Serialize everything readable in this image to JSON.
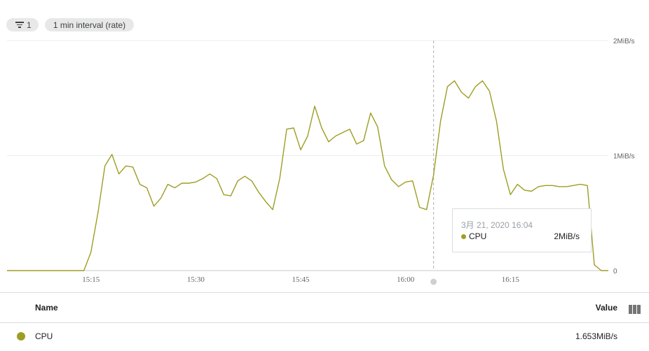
{
  "toolbar": {
    "filter_count": "1",
    "interval_label": "1 min interval (rate)"
  },
  "chart_data": {
    "type": "line",
    "title": "",
    "xlabel": "",
    "ylabel": "",
    "x_unit": "minutes",
    "x_ticks": [
      {
        "x": 915,
        "label": "15:15"
      },
      {
        "x": 930,
        "label": "15:30"
      },
      {
        "x": 945,
        "label": "15:45"
      },
      {
        "x": 960,
        "label": "16:00"
      },
      {
        "x": 975,
        "label": "16:15"
      }
    ],
    "xlim": [
      903,
      989
    ],
    "y_unit": "MiB/s",
    "y_ticks": [
      {
        "y": 0,
        "label": "0"
      },
      {
        "y": 1,
        "label": "1MiB/s"
      },
      {
        "y": 2,
        "label": "2MiB/s"
      }
    ],
    "ylim": [
      0,
      2
    ],
    "grid": true,
    "color": "#9e9d24",
    "series": [
      {
        "name": "CPU",
        "x": [
          903,
          904,
          905,
          906,
          907,
          908,
          909,
          910,
          911,
          912,
          913,
          914,
          915,
          916,
          917,
          918,
          919,
          920,
          921,
          922,
          923,
          924,
          925,
          926,
          927,
          928,
          929,
          930,
          931,
          932,
          933,
          934,
          935,
          936,
          937,
          938,
          939,
          940,
          941,
          942,
          943,
          944,
          945,
          946,
          947,
          948,
          949,
          950,
          951,
          952,
          953,
          954,
          955,
          956,
          957,
          958,
          959,
          960,
          961,
          962,
          963,
          964,
          965,
          966,
          967,
          968,
          969,
          970,
          971,
          972,
          973,
          974,
          975,
          976,
          977,
          978,
          979,
          980,
          981,
          982,
          983,
          984,
          985,
          986,
          987,
          988,
          989
        ],
        "y": [
          0,
          0,
          0,
          0,
          0,
          0,
          0,
          0,
          0,
          0,
          0,
          0,
          0.16,
          0.5,
          0.91,
          1.01,
          0.84,
          0.91,
          0.9,
          0.75,
          0.72,
          0.56,
          0.63,
          0.75,
          0.72,
          0.76,
          0.76,
          0.77,
          0.8,
          0.84,
          0.8,
          0.66,
          0.65,
          0.78,
          0.82,
          0.78,
          0.68,
          0.6,
          0.53,
          0.8,
          1.23,
          1.24,
          1.05,
          1.17,
          1.43,
          1.24,
          1.12,
          1.17,
          1.2,
          1.23,
          1.1,
          1.13,
          1.37,
          1.25,
          0.91,
          0.79,
          0.73,
          0.77,
          0.78,
          0.55,
          0.53,
          0.83,
          1.3,
          1.6,
          1.65,
          1.55,
          1.5,
          1.6,
          1.65,
          1.56,
          1.3,
          0.88,
          0.66,
          0.75,
          0.7,
          0.69,
          0.73,
          0.74,
          0.74,
          0.73,
          0.73,
          0.74,
          0.75,
          0.74,
          0.05,
          0,
          0
        ]
      }
    ],
    "cursor_x": 964
  },
  "tooltip": {
    "time": "3月 21, 2020 16:04",
    "series_name": "CPU",
    "value": "2MiB/s"
  },
  "legend": {
    "name_header": "Name",
    "value_header": "Value",
    "rows": [
      {
        "name": "CPU",
        "value": "1.653MiB/s",
        "color": "#9e9d24"
      }
    ]
  }
}
